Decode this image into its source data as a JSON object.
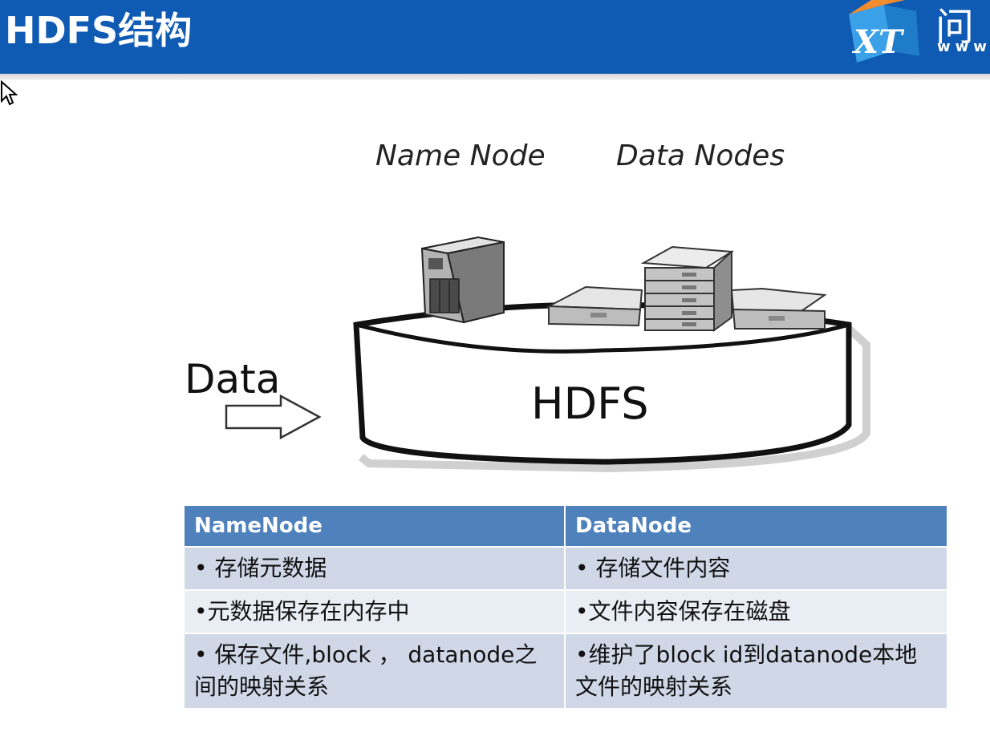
{
  "header": {
    "title": "HDFS结构",
    "logo_glyph": "问",
    "logo_letters": "XT",
    "logo_www": "www",
    "bar_color": "#0f5bb4"
  },
  "diagram": {
    "name_node_label": "Name Node",
    "data_nodes_label": "Data Nodes",
    "data_label": "Data",
    "hdfs_label": "HDFS",
    "icons": [
      "tower-server-icon",
      "rack-server-icon",
      "rack-server-stack-icon",
      "rack-server-icon",
      "arrow-right-icon",
      "mouse-cursor-icon"
    ]
  },
  "table": {
    "headers": [
      "NameNode",
      "DataNode"
    ],
    "rows": [
      [
        "• 存储元数据",
        "• 存储文件内容"
      ],
      [
        "•元数据保存在内存中",
        "•文件内容保存在磁盘"
      ],
      [
        "• 保存文件,block ， datanode之间的映射关系",
        "•维护了block id到datanode本地文件的映射关系"
      ]
    ],
    "header_color": "#4f81bd",
    "row_colors": [
      "#d0d8e8",
      "#e9edf4"
    ]
  }
}
